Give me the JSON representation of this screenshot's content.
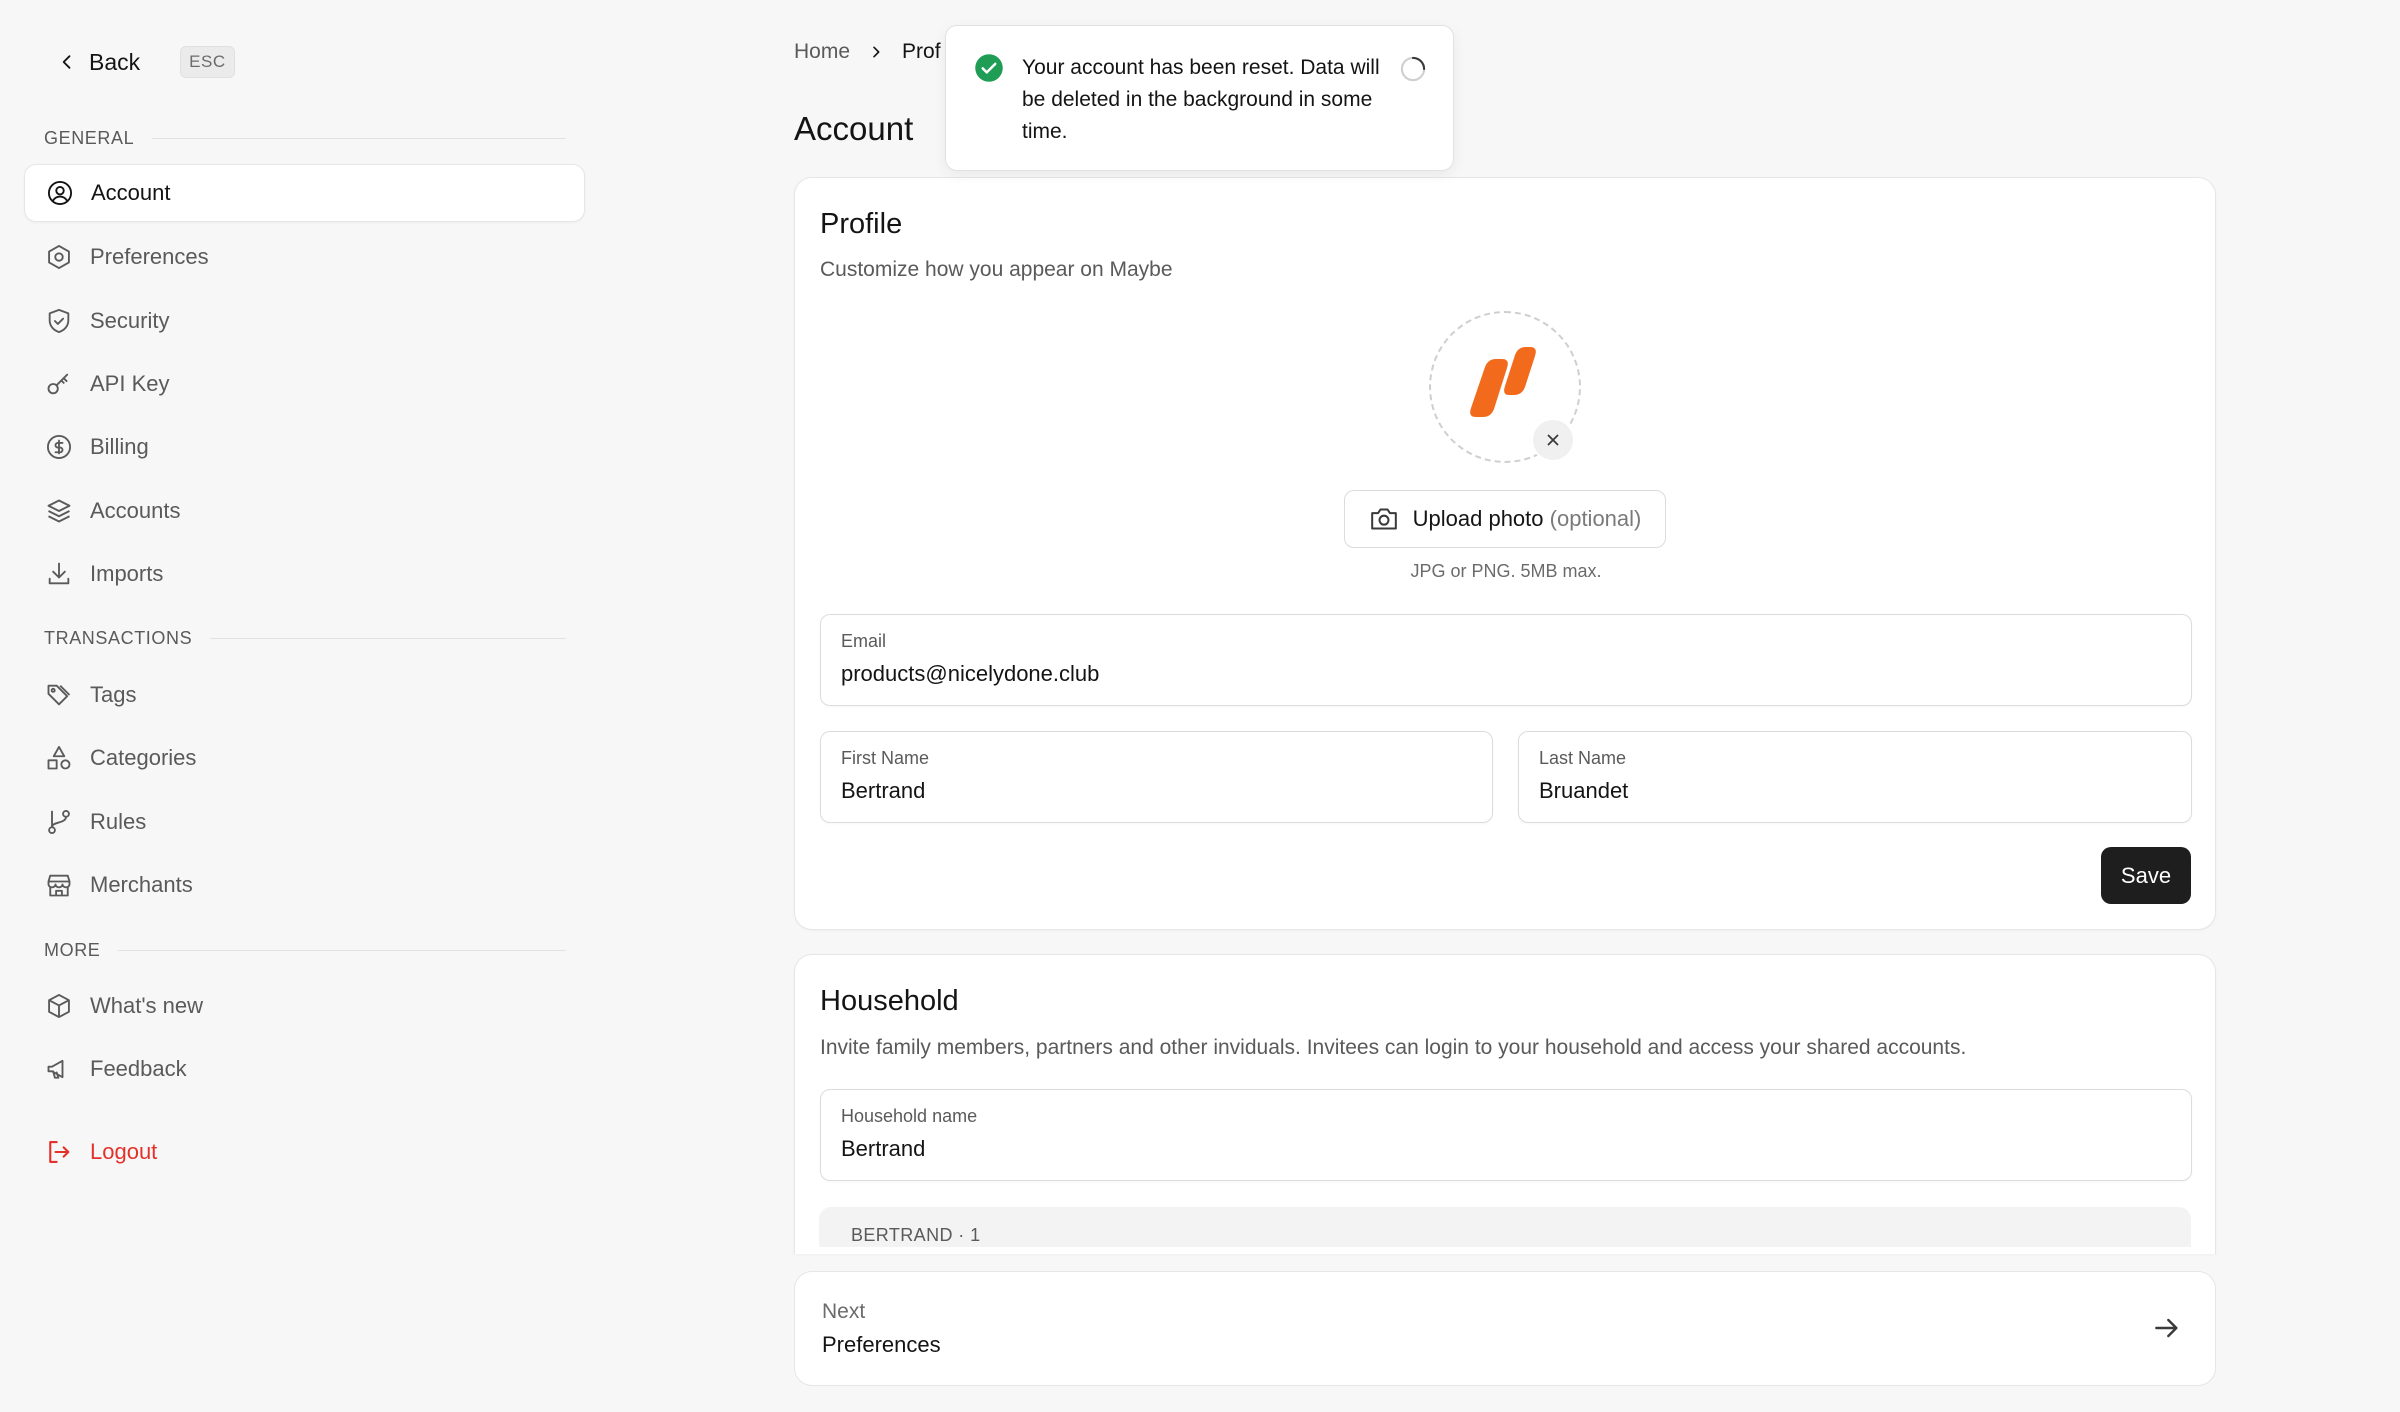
{
  "sidebar": {
    "back_label": "Back",
    "esc_label": "ESC",
    "sections": {
      "general": "GENERAL",
      "transactions": "TRANSACTIONS",
      "more": "MORE"
    },
    "items": {
      "account": "Account",
      "preferences": "Preferences",
      "security": "Security",
      "api_key": "API Key",
      "billing": "Billing",
      "accounts": "Accounts",
      "imports": "Imports",
      "tags": "Tags",
      "categories": "Categories",
      "rules": "Rules",
      "merchants": "Merchants",
      "whats_new": "What's new",
      "feedback": "Feedback",
      "logout": "Logout"
    }
  },
  "breadcrumb": {
    "home": "Home",
    "current": "Prof"
  },
  "page_title": "Account",
  "profile": {
    "title": "Profile",
    "subtitle": "Customize how you appear on Maybe",
    "upload_label": "Upload photo",
    "upload_optional": "(optional)",
    "upload_hint": "JPG or PNG. 5MB max.",
    "email_label": "Email",
    "email_value": "products@nicelydone.club",
    "first_name_label": "First Name",
    "first_name_value": "Bertrand",
    "last_name_label": "Last Name",
    "last_name_value": "Bruandet",
    "save_label": "Save"
  },
  "household": {
    "title": "Household",
    "subtitle": "Invite family members, partners and other inviduals. Invitees can login to your household and access your shared accounts.",
    "name_label": "Household name",
    "name_value": "Bertrand",
    "members_header": "BERTRAND · 1"
  },
  "next": {
    "label": "Next",
    "target": "Preferences"
  },
  "toast": {
    "message": "Your account has been reset. Data will be deleted in the background in some time."
  },
  "colors": {
    "accent": "#1e1e1e",
    "danger": "#e4312b",
    "success": "#1f9d55",
    "brand": "#f26a1b"
  }
}
